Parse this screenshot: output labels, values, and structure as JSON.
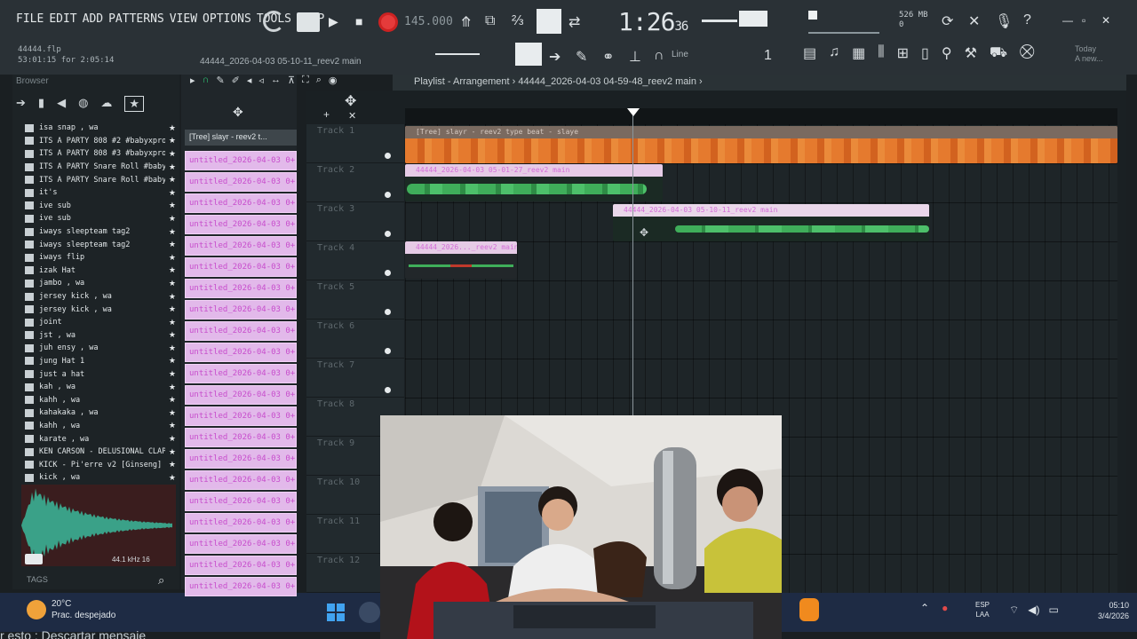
{
  "menu": [
    "FILE",
    "EDIT",
    "ADD",
    "PATTERNS",
    "VIEW",
    "OPTIONS",
    "TOOLS",
    "HELP"
  ],
  "project": {
    "browser_label": "44444.flp",
    "elapsed": "53:01:15 for 2:05:14",
    "title": "44444_2026-04-03 05-10-11_reev2 main"
  },
  "transport": {
    "bpm": "145.000",
    "time_main": "1:26",
    "time_small": "36",
    "snap": "Line",
    "memory_top": "526 MB",
    "memory_bottom": "0"
  },
  "today_tip": {
    "label": "Today",
    "text": "A new..."
  },
  "browser": {
    "header": "Browser",
    "items": [
      {
        "label": "isa snap , wa"
      },
      {
        "label": "ITS A PARTY 808 #2 #babyxprod"
      },
      {
        "label": "ITS A PARTY 808 #3 #babyxprod"
      },
      {
        "label": "ITS A PARTY Snare Roll #babyxprod"
      },
      {
        "label": "ITS A PARTY Snare Roll #babyxprod"
      },
      {
        "label": "it's"
      },
      {
        "label": "ive sub"
      },
      {
        "label": "ive sub"
      },
      {
        "label": "iways sleepteam tag2"
      },
      {
        "label": "iways sleepteam tag2"
      },
      {
        "label": "iways flip"
      },
      {
        "label": "izak Hat"
      },
      {
        "label": "jambo , wa"
      },
      {
        "label": "jersey kick , wa"
      },
      {
        "label": "jersey kick , wa"
      },
      {
        "label": "joint"
      },
      {
        "label": "jst , wa"
      },
      {
        "label": "juh ensy , wa"
      },
      {
        "label": "jung Hat 1"
      },
      {
        "label": "just a hat"
      },
      {
        "label": "kah , wa"
      },
      {
        "label": "kahh , wa"
      },
      {
        "label": "kahakaka , wa"
      },
      {
        "label": "kahh , wa"
      },
      {
        "label": "karate , wa"
      },
      {
        "label": "KEN CARSON - DELUSIONAL CLAP"
      },
      {
        "label": "KICK - Pi'erre v2 [Ginseng]"
      },
      {
        "label": "kick , wa"
      }
    ],
    "sample_info": "44.1 kHz 16",
    "tags_label": "TAGS"
  },
  "patterns": {
    "header": "[Tree] slayr - reev2 t...",
    "items": [
      "untitled_2026-04-03 0+",
      "untitled_2026-04-03 0+",
      "untitled_2026-04-03 0+",
      "untitled_2026-04-03 0+",
      "untitled_2026-04-03 0+",
      "untitled_2026-04-03 0+",
      "untitled_2026-04-03 0+",
      "untitled_2026-04-03 0+",
      "untitled_2026-04-03 0+",
      "untitled_2026-04-03 0+",
      "untitled_2026-04-03 0+",
      "untitled_2026-04-03 0+",
      "untitled_2026-04-03 0+",
      "untitled_2026-04-03 0+",
      "untitled_2026-04-03 0+",
      "untitled_2026-04-03 0+",
      "untitled_2026-04-03 0+",
      "untitled_2026-04-03 0+",
      "untitled_2026-04-03 0+",
      "untitled_2026-04-03 0+",
      "untitled_2026-04-03 0+"
    ]
  },
  "playlist": {
    "title": "Playlist - Arrangement › 44444_2026-04-03 04-59-48_reev2 main ›",
    "tracks": [
      "Track 1",
      "Track 2",
      "Track 3",
      "Track 4",
      "Track 5",
      "Track 6",
      "Track 7",
      "Track 8",
      "Track 9",
      "Track 10",
      "Track 11",
      "Track 12"
    ],
    "clips": [
      {
        "label": "[Tree] slayr - reev2 type beat - slaye"
      },
      {
        "label": "44444_2026-04-03 05-01-27_reev2 main"
      },
      {
        "label": "44444_2026-04-03 05-10-11_reev2 main"
      },
      {
        "label": "44444_2026..._reev2 main"
      }
    ]
  },
  "taskbar": {
    "temperature": "20°C",
    "weather": "Prac. despejado",
    "lang_top": "ESP",
    "lang_bottom": "LAA",
    "time": "05:10",
    "date": "3/4/2026"
  },
  "overlay_message": "r esto :  Descartar mensaje",
  "colors": {
    "accent_clip": "#e06a2a",
    "pattern_bg": "#e2b9ea",
    "pattern_text": "#c74dcc",
    "wave_green": "#3fae5a",
    "record": "#e53b3b"
  }
}
